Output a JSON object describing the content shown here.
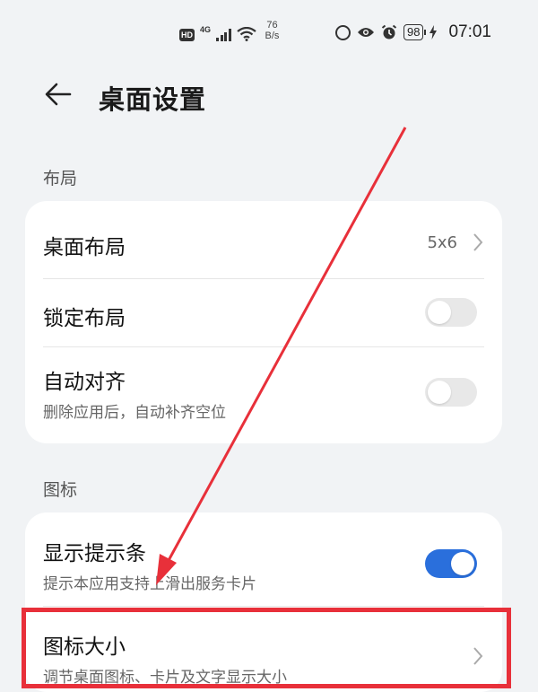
{
  "status_bar": {
    "hd": "HD",
    "network": "4G",
    "speed_value": "76",
    "speed_unit": "B/s",
    "battery": "98",
    "time": "07:01"
  },
  "header": {
    "title": "桌面设置"
  },
  "sections": {
    "layout": {
      "label": "布局",
      "desktop_layout": {
        "title": "桌面布局",
        "value": "5x6"
      },
      "lock_layout": {
        "title": "锁定布局",
        "enabled": false
      },
      "auto_align": {
        "title": "自动对齐",
        "subtitle": "删除应用后，自动补齐空位",
        "enabled": false
      }
    },
    "icons": {
      "label": "图标",
      "show_hint_bar": {
        "title": "显示提示条",
        "subtitle": "提示本应用支持上滑出服务卡片",
        "enabled": true
      },
      "icon_size": {
        "title": "图标大小",
        "subtitle": "调节桌面图标、卡片及文字显示大小"
      }
    }
  },
  "annotation": {
    "color": "#e8303a"
  },
  "colors": {
    "accent": "#2a6fdc",
    "background": "#f1f3f5"
  }
}
